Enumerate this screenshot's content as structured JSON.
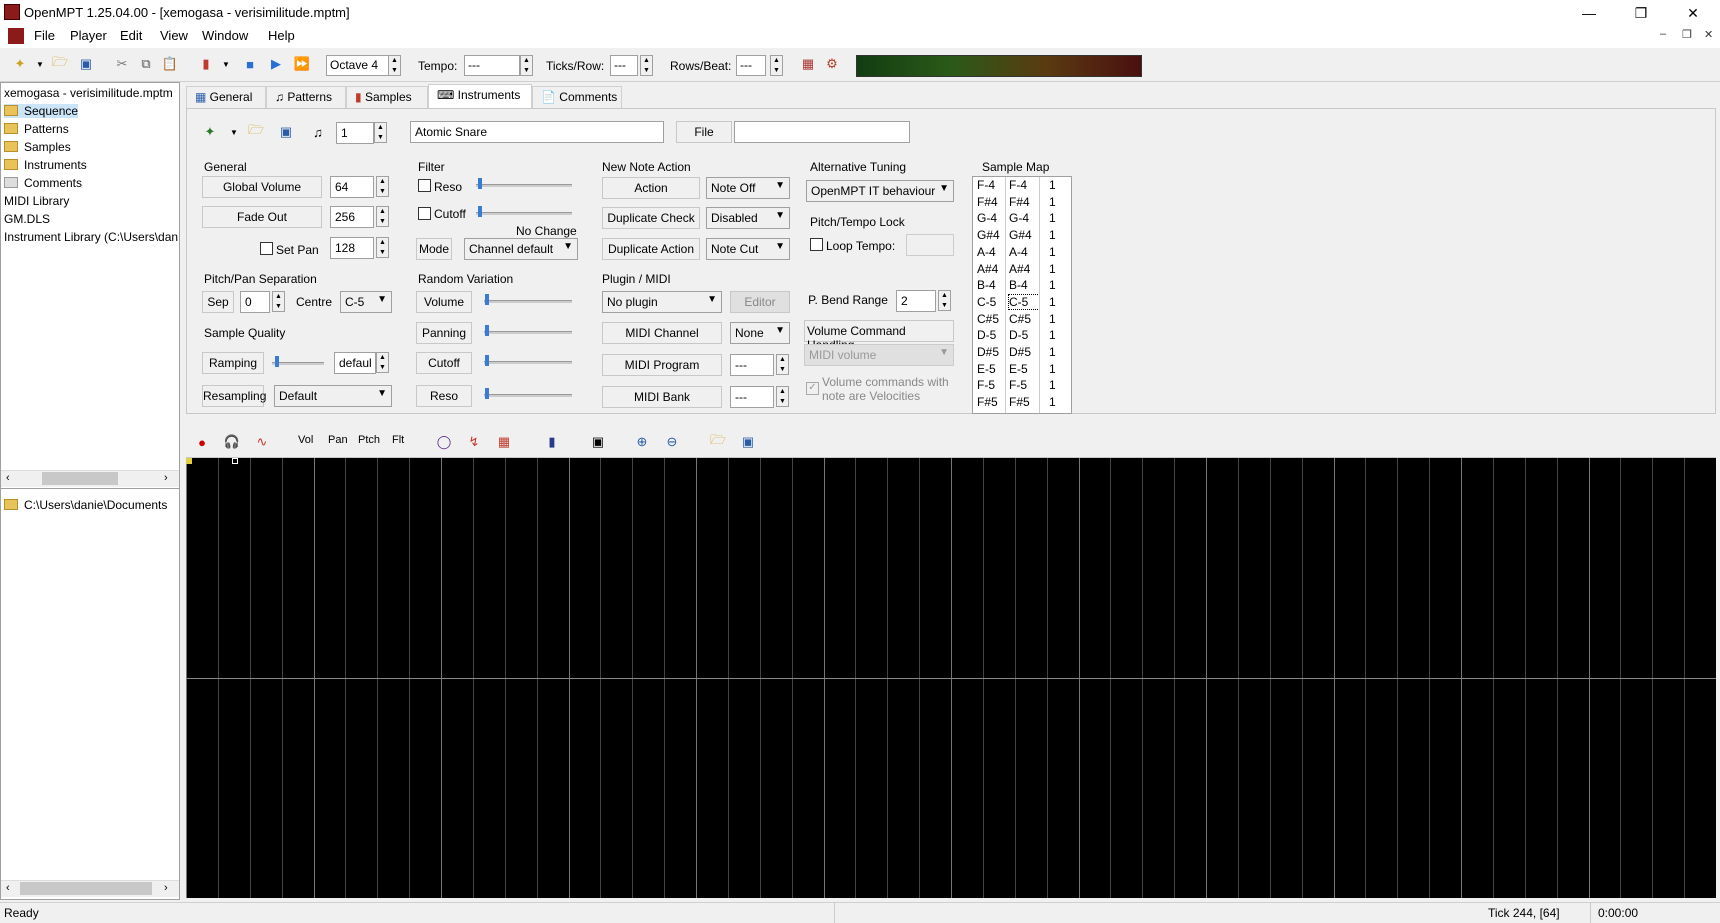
{
  "window": {
    "title": "OpenMPT 1.25.04.00 - [xemogasa - verisimilitude.mptm]"
  },
  "menu": [
    "File",
    "Player",
    "Edit",
    "View",
    "Window",
    "Help"
  ],
  "toolbar": {
    "octave": "Octave 4",
    "tempo_label": "Tempo:",
    "tempo_value": "---",
    "ticks_label": "Ticks/Row:",
    "ticks_value": "---",
    "rows_label": "Rows/Beat:",
    "rows_value": "---"
  },
  "tree": {
    "items": [
      "xemogasa - verisimilitude.mptm",
      "Sequence",
      "Patterns",
      "Samples",
      "Instruments",
      "Comments",
      "MIDI Library",
      "GM.DLS",
      "Instrument Library (C:\\Users\\dan"
    ],
    "path": "C:\\Users\\danie\\Documents"
  },
  "tabs": [
    "General",
    "Patterns",
    "Samples",
    "Instruments",
    "Comments"
  ],
  "instrument": {
    "number": "1",
    "name": "Atomic Snare",
    "file_label": "File",
    "file_value": ""
  },
  "general": {
    "heading": "General",
    "global_volume_label": "Global Volume",
    "global_volume": "64",
    "fade_out_label": "Fade Out",
    "fade_out": "256",
    "set_pan_label": "Set Pan",
    "set_pan": "128",
    "pps_heading": "Pitch/Pan Separation",
    "sep_label": "Sep",
    "sep": "0",
    "centre_label": "Centre",
    "centre": "C-5",
    "sq_heading": "Sample Quality",
    "ramping_label": "Ramping",
    "ramping": "defaul",
    "resampling_label": "Resampling",
    "resampling": "Default"
  },
  "filter": {
    "heading": "Filter",
    "reso_label": "Reso",
    "cutoff_label": "Cutoff",
    "no_change": "No Change",
    "mode_label": "Mode",
    "mode": "Channel default"
  },
  "random": {
    "heading": "Random Variation",
    "volume": "Volume",
    "panning": "Panning",
    "cutoff": "Cutoff",
    "reso": "Reso"
  },
  "nna": {
    "heading": "New Note Action",
    "action_label": "Action",
    "action": "Note Off",
    "dc_label": "Duplicate Check",
    "dc": "Disabled",
    "da_label": "Duplicate Action",
    "da": "Note Cut"
  },
  "plugin": {
    "heading": "Plugin / MIDI",
    "plugin": "No plugin",
    "editor": "Editor",
    "channel_label": "MIDI Channel",
    "channel": "None",
    "program_label": "MIDI Program",
    "program": "---",
    "bank_label": "MIDI Bank",
    "bank": "---"
  },
  "tuning": {
    "heading": "Alternative Tuning",
    "value": "OpenMPT IT behaviour",
    "ptl_heading": "Pitch/Tempo Lock",
    "loop_tempo": "Loop Tempo:",
    "bend_label": "P. Bend Range",
    "bend": "2",
    "vch": "Volume Command Handling",
    "vch_value": "MIDI volume",
    "vel_text": "Volume commands with note are Velocities"
  },
  "sample_map": {
    "heading": "Sample Map",
    "rows": [
      [
        "F-4",
        "F-4",
        "1"
      ],
      [
        "F#4",
        "F#4",
        "1"
      ],
      [
        "G-4",
        "G-4",
        "1"
      ],
      [
        "G#4",
        "G#4",
        "1"
      ],
      [
        "A-4",
        "A-4",
        "1"
      ],
      [
        "A#4",
        "A#4",
        "1"
      ],
      [
        "B-4",
        "B-4",
        "1"
      ],
      [
        "C-5",
        "C-5",
        "1"
      ],
      [
        "C#5",
        "C#5",
        "1"
      ],
      [
        "D-5",
        "D-5",
        "1"
      ],
      [
        "D#5",
        "D#5",
        "1"
      ],
      [
        "E-5",
        "E-5",
        "1"
      ],
      [
        "F-5",
        "F-5",
        "1"
      ],
      [
        "F#5",
        "F#5",
        "1"
      ]
    ]
  },
  "env_toolbar": {
    "vol": "Vol",
    "pan": "Pan",
    "ptch": "Ptch",
    "flt": "Flt"
  },
  "status": {
    "ready": "Ready",
    "tick": "Tick 244, [64]",
    "time": "0:00:00"
  }
}
